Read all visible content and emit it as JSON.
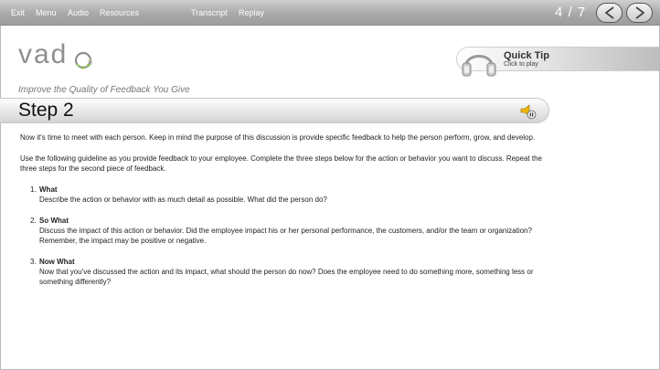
{
  "menu": {
    "exit": "Exit",
    "menu": "Menu",
    "audio": "Audio",
    "resources": "Resources",
    "transcript": "Transcript",
    "replay": "Replay"
  },
  "pager": {
    "text": "4 / 7"
  },
  "brand": {
    "logo_text": "vad",
    "reg": "®"
  },
  "subtitle": "Improve the Quality of Feedback You Give",
  "quick_tip": {
    "title": "Quick Tip",
    "subtitle": "Click to play"
  },
  "step": {
    "title": "Step 2"
  },
  "content": {
    "para1": "Now it's time to meet with each person. Keep in mind the purpose of this discussion is provide specific feedback to help the person perform, grow, and develop.",
    "para2": "Use the following guideline as you provide feedback to your employee. Complete the three steps below for the action or behavior you want to discuss. Repeat the three steps for the second piece of feedback.",
    "items": [
      {
        "num": "1.",
        "title": "What",
        "text": "Describe the action or behavior with as much detail as possible. What did the person do?"
      },
      {
        "num": "2.",
        "title": "So What",
        "text": "Discuss the impact of this action or behavior. Did the employee impact his or her personal performance, the customers, and/or the team or organization? Remember, the impact may be positive or negative."
      },
      {
        "num": "3.",
        "title": "Now What",
        "text": "Now that you've discussed the action and its impact, what should the person do now? Does the employee need to do something more, something less or something differently?"
      }
    ]
  },
  "colors": {
    "topbar": "#a9a9a9",
    "logo_green": "#8cc63f",
    "logo_gray": "#8f8f8f"
  },
  "icons": {
    "prev": "chevron-left-icon",
    "next": "chevron-right-icon",
    "quick_tip": "headphones-icon",
    "audio": "speaker-icon"
  }
}
